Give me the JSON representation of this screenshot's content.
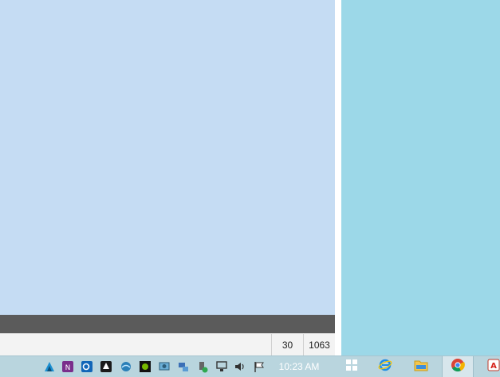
{
  "status_bar": {
    "cells": [
      "30",
      "1063"
    ]
  },
  "taskbar": {
    "clock": "10:23 AM",
    "tray_icons": [
      "autodesk-icon",
      "onenote-icon",
      "outlook-icon",
      "inkscape-icon",
      "cloud-sync-icon",
      "nvidia-icon",
      "screen-capture-icon",
      "network-sharing-icon",
      "usb-safe-remove-icon",
      "network-icon",
      "volume-icon",
      "action-center-flag-icon"
    ],
    "pinned": [
      {
        "name": "windows-icon"
      },
      {
        "name": "internet-explorer-icon"
      },
      {
        "name": "file-explorer-icon"
      },
      {
        "name": "chrome-icon",
        "active": true
      },
      {
        "name": "acrobat-icon"
      }
    ]
  },
  "colors": {
    "left_window": "#c5dcf3",
    "right_pane": "#9cd8e8",
    "dark_bar": "#5b5b5b",
    "taskbar": "#b9d5de"
  }
}
